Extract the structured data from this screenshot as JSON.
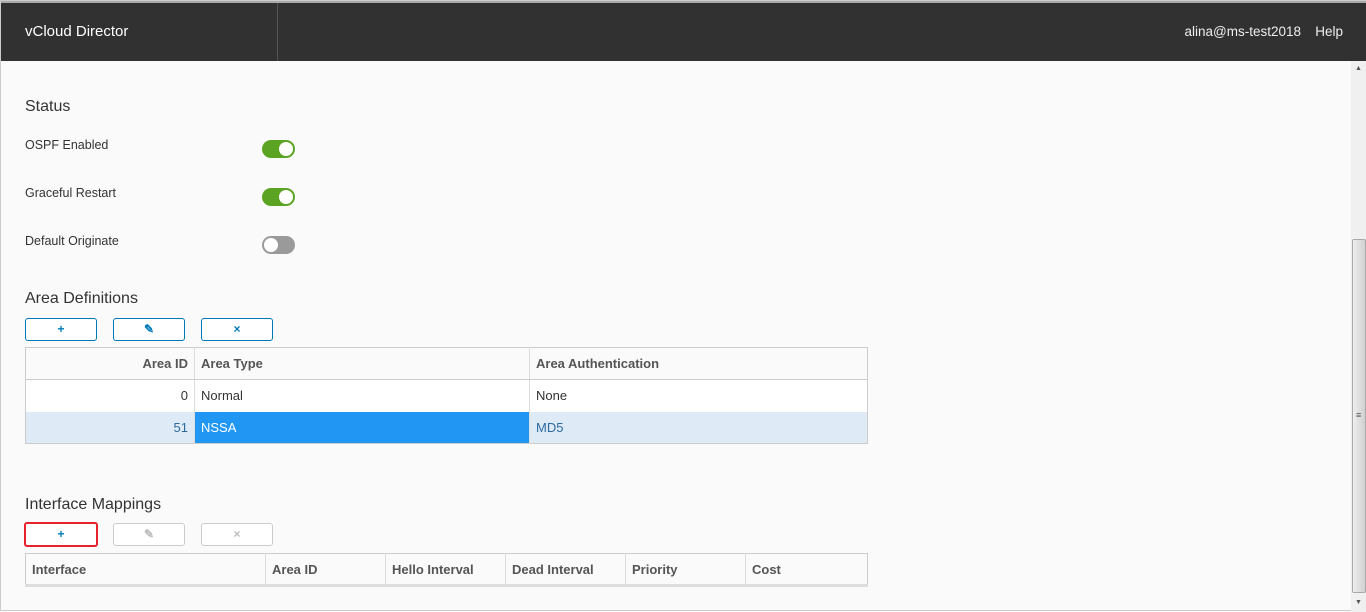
{
  "header": {
    "title": "vCloud Director",
    "user": "alina@ms-test2018",
    "help": "Help"
  },
  "status": {
    "title": "Status",
    "toggles": [
      {
        "label": "OSPF Enabled",
        "on": true
      },
      {
        "label": "Graceful Restart",
        "on": true
      },
      {
        "label": "Default Originate",
        "on": false
      }
    ]
  },
  "area": {
    "title": "Area Definitions",
    "buttons": {
      "add": "+",
      "edit": "✎",
      "delete": "×"
    },
    "columns": [
      "Area ID",
      "Area Type",
      "Area Authentication"
    ],
    "rows": [
      [
        "0",
        "Normal",
        "None"
      ],
      [
        "51",
        "NSSA",
        "MD5"
      ]
    ]
  },
  "iface": {
    "title": "Interface Mappings",
    "buttons": {
      "add": "+",
      "edit": "✎",
      "delete": "×"
    },
    "columns": [
      "Interface",
      "Area ID",
      "Hello Interval",
      "Dead Interval",
      "Priority",
      "Cost"
    ]
  }
}
